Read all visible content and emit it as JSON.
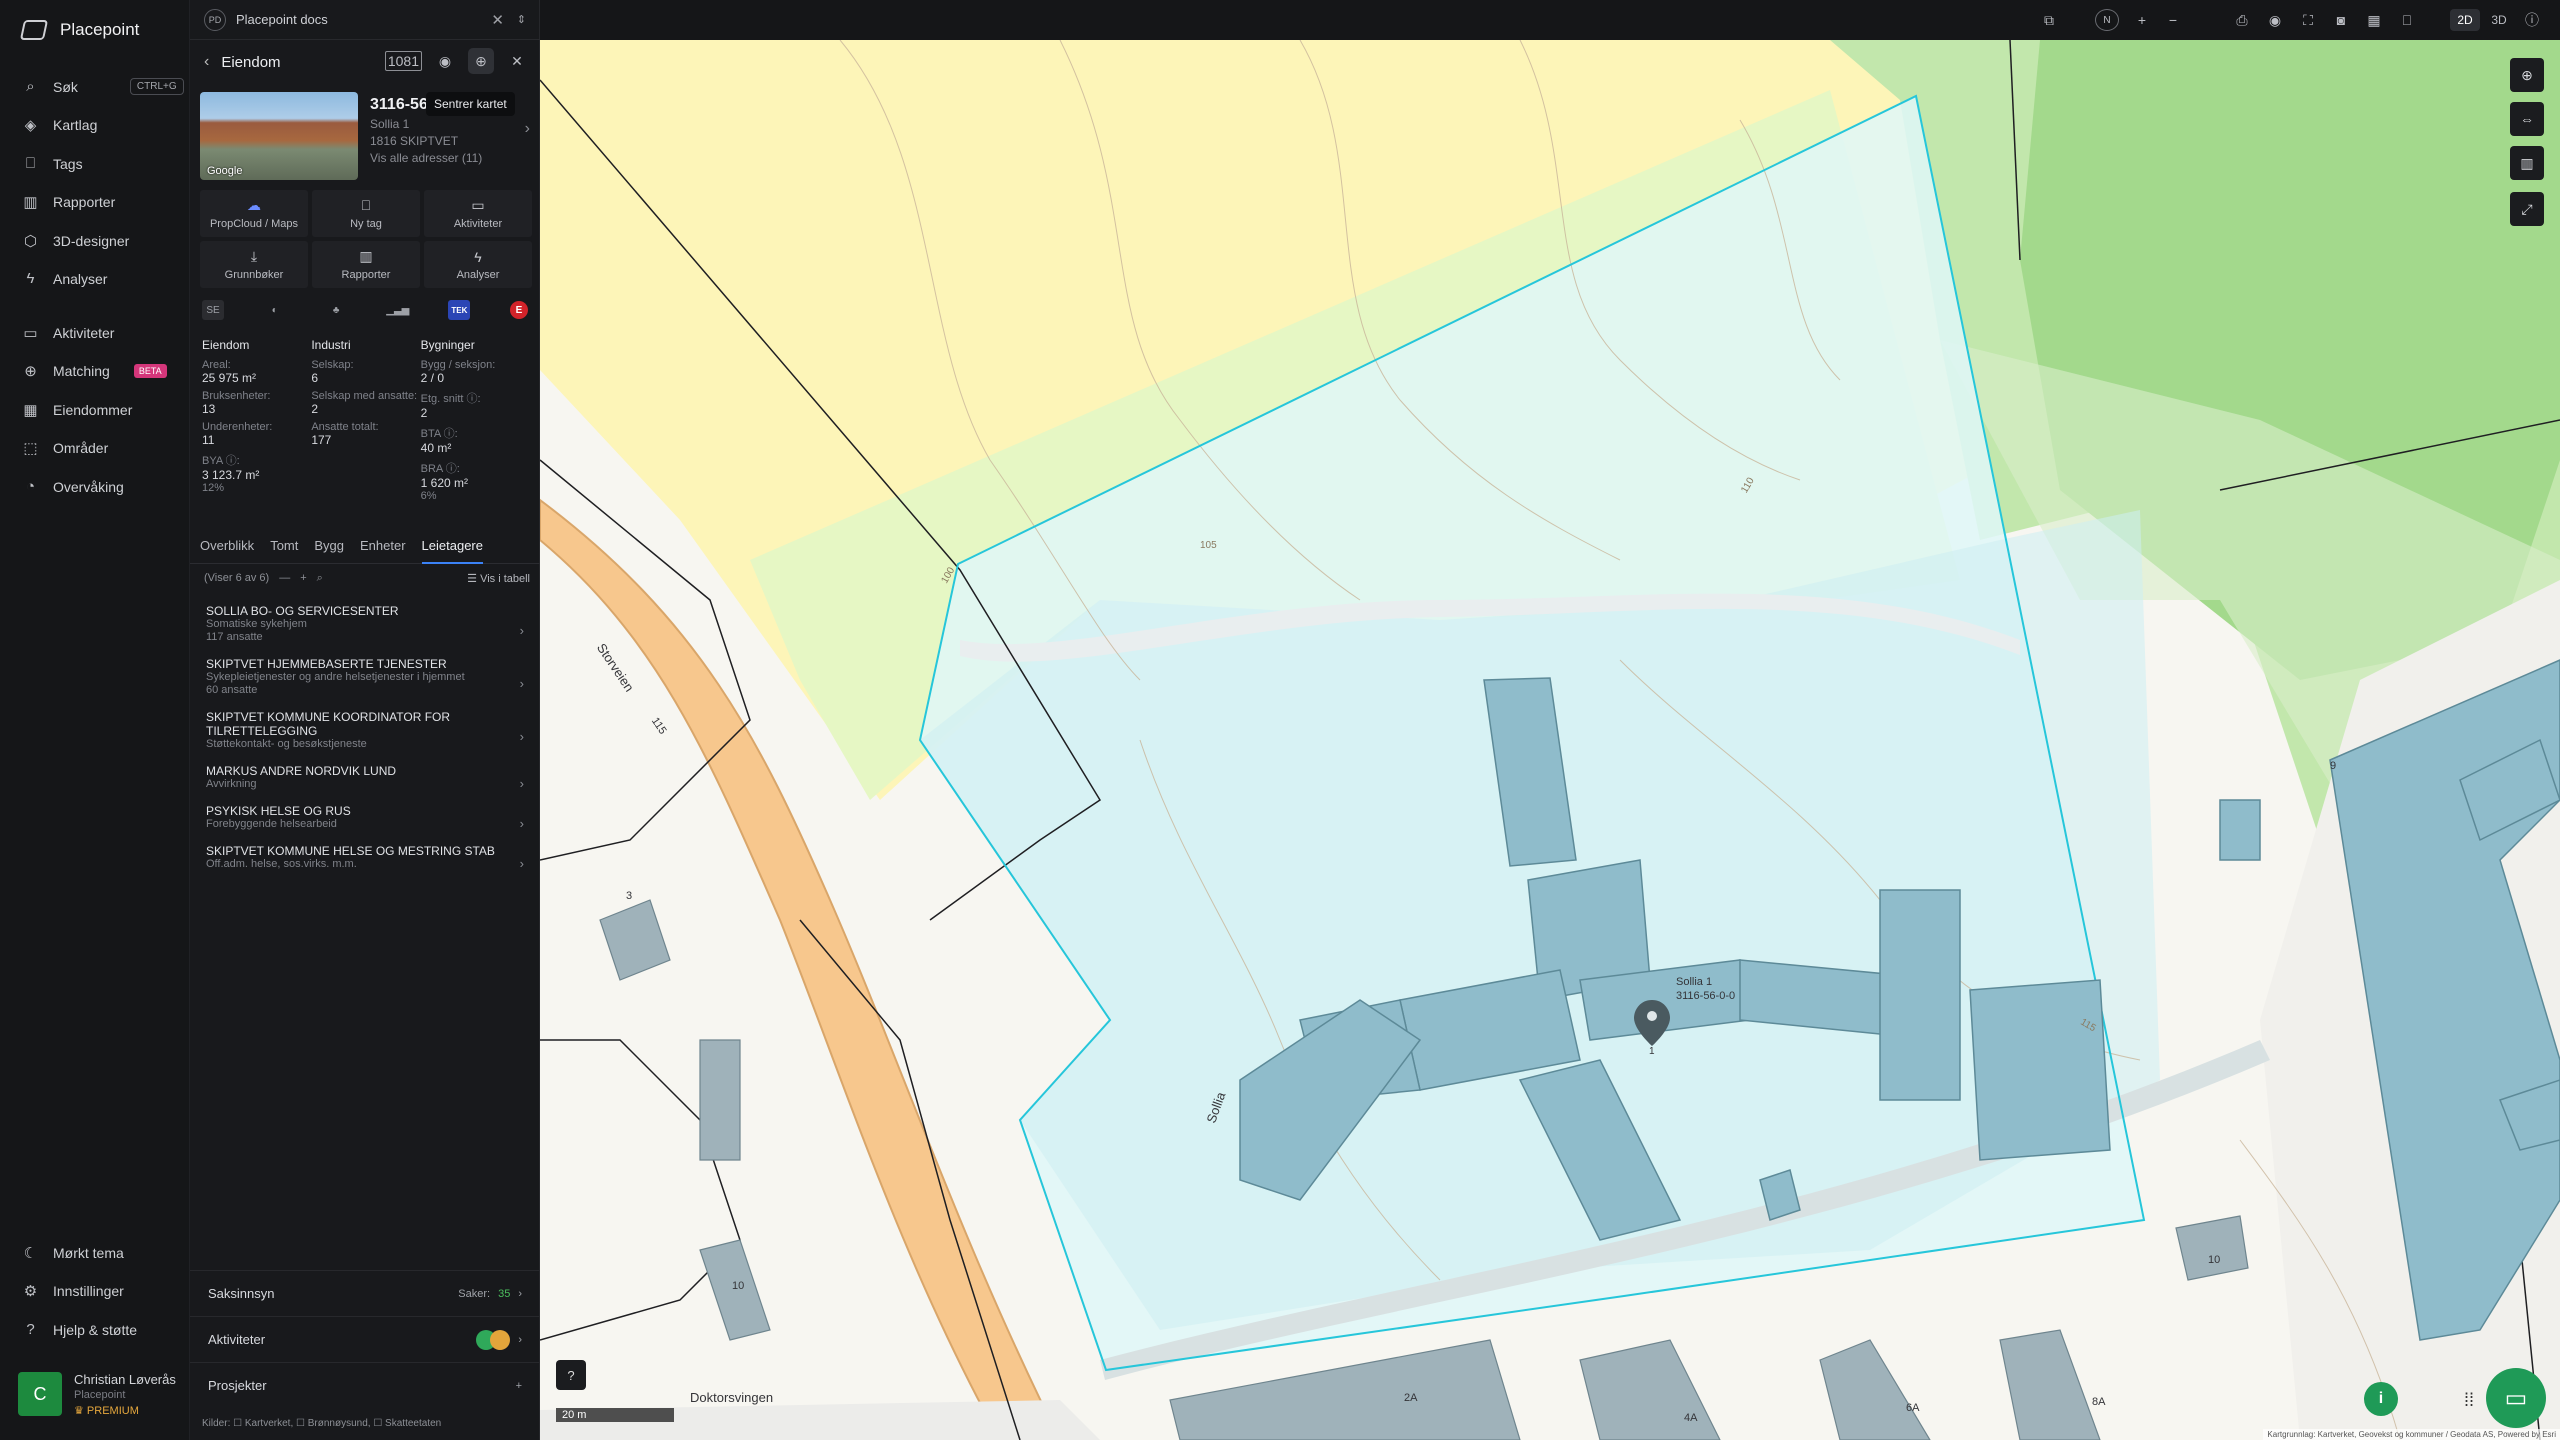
{
  "app": {
    "name": "Placepoint"
  },
  "nav": {
    "items": [
      {
        "label": "Søk",
        "icon": "search-icon",
        "shortcut": "CTRL+G"
      },
      {
        "label": "Kartlag",
        "icon": "layers-icon"
      },
      {
        "label": "Tags",
        "icon": "bookmark-icon"
      },
      {
        "label": "Rapporter",
        "icon": "chart-icon"
      },
      {
        "label": "3D-designer",
        "icon": "cube-icon"
      },
      {
        "label": "Analyser",
        "icon": "bolt-icon"
      },
      {
        "label": "Aktiviteter",
        "icon": "chat-icon"
      },
      {
        "label": "Matching",
        "icon": "match-icon",
        "badge": "BETA"
      },
      {
        "label": "Eiendommer",
        "icon": "building-icon"
      },
      {
        "label": "Områder",
        "icon": "area-icon"
      },
      {
        "label": "Overvåking",
        "icon": "monitor-icon"
      }
    ],
    "bottom": [
      {
        "label": "Mørkt tema",
        "icon": "moon-icon"
      },
      {
        "label": "Innstillinger",
        "icon": "gear-icon"
      },
      {
        "label": "Hjelp & støtte",
        "icon": "help-icon"
      }
    ],
    "user": {
      "initial": "C",
      "name": "Christian Løverås",
      "org": "Placepoint",
      "plan": "PREMIUM"
    }
  },
  "doc": {
    "badge": "PD",
    "title": "Placepoint docs"
  },
  "panel": {
    "title": "Eiendom",
    "tooltip": "Sentrer kartet",
    "icons": {
      "badge": "1081"
    },
    "property": {
      "gnr": "3116-56",
      "address": "Sollia 1",
      "postal": "1816 SKIPTVET",
      "all_addresses": "Vis alle adresser (11)",
      "photo_credit": "Google"
    },
    "actions": [
      {
        "label": "PropCloud / Maps",
        "icon": "cloud-icon"
      },
      {
        "label": "Ny tag",
        "icon": "bookmark-icon"
      },
      {
        "label": "Aktiviteter",
        "icon": "chat-icon"
      },
      {
        "label": "Grunnbøker",
        "icon": "download-icon"
      },
      {
        "label": "Rapporter",
        "icon": "chart-icon"
      },
      {
        "label": "Analyser",
        "icon": "bolt-icon"
      }
    ],
    "sources": [
      "SE",
      "TEK",
      "E"
    ],
    "stats": {
      "cols": [
        {
          "heading": "Eiendom",
          "rows": [
            {
              "k": "Areal:",
              "v": "25 975 m²"
            },
            {
              "k": "Bruksenheter:",
              "v": "13"
            },
            {
              "k": "Underenheter:",
              "v": "11"
            },
            {
              "k": "BYA ⓘ:",
              "v": "3 123.7 m²",
              "s": "12%"
            }
          ]
        },
        {
          "heading": "Industri",
          "rows": [
            {
              "k": "Selskap:",
              "v": "6"
            },
            {
              "k": "Selskap med ansatte:",
              "v": "2"
            },
            {
              "k": "Ansatte totalt:",
              "v": "177"
            }
          ]
        },
        {
          "heading": "Bygninger",
          "rows": [
            {
              "k": "Bygg / seksjon:",
              "v": "2 / 0"
            },
            {
              "k": "Etg. snitt ⓘ:",
              "v": "2"
            },
            {
              "k": "BTA ⓘ:",
              "v": "40 m²"
            },
            {
              "k": "BRA ⓘ:",
              "v": "1 620 m²",
              "s": "6%"
            }
          ]
        }
      ]
    },
    "tabs": [
      "Overblikk",
      "Tomt",
      "Bygg",
      "Enheter",
      "Leietagere"
    ],
    "active_tab": "Leietagere",
    "list": {
      "count": "(Viser 6 av 6)",
      "view_toggle": "Vis i tabell"
    },
    "tenants": [
      {
        "name": "SOLLIA BO- OG SERVICESENTER",
        "desc": "Somatiske sykehjem",
        "emp": "117 ansatte"
      },
      {
        "name": "SKIPTVET HJEMMEBASERTE TJENESTER",
        "desc": "Sykepleietjenester og andre helsetjenester i hjemmet",
        "emp": "60 ansatte"
      },
      {
        "name": "SKIPTVET KOMMUNE KOORDINATOR FOR TILRETTELEGGING",
        "desc": "Støttekontakt- og besøkstjeneste",
        "emp": ""
      },
      {
        "name": "MARKUS ANDRE NORDVIK LUND",
        "desc": "Avvirkning",
        "emp": ""
      },
      {
        "name": "PSYKISK HELSE OG RUS",
        "desc": "Forebyggende helsearbeid",
        "emp": ""
      },
      {
        "name": "SKIPTVET KOMMUNE HELSE OG MESTRING STAB",
        "desc": "Off.adm. helse, sos.virks. m.m.",
        "emp": ""
      }
    ],
    "sections": [
      {
        "label": "Saksinnsyn",
        "right_label": "Saker:",
        "right_value": "35"
      },
      {
        "label": "Aktiviteter"
      },
      {
        "label": "Prosjekter"
      }
    ],
    "sources_footer": "Kilder: ☐ Kartverket, ☐ Brønnøysund, ☐ Skatteetaten"
  },
  "map": {
    "mode_2d": "2D",
    "mode_3d": "3D",
    "compass": "N",
    "labels": [
      {
        "text": "Storveien",
        "kind": "road"
      },
      {
        "text": "Sollia",
        "kind": "road"
      },
      {
        "text": "Doktorsvingen",
        "kind": "road"
      },
      {
        "text": "115",
        "kind": "route"
      },
      {
        "text": "Sollia 1",
        "kind": "address"
      },
      {
        "text": "3116-56-0-0",
        "kind": "parcel"
      }
    ],
    "contours": [
      "100",
      "105",
      "110",
      "115"
    ],
    "house_numbers": [
      "3",
      "9",
      "10",
      "10",
      "2A",
      "4A",
      "6A",
      "8A",
      "1"
    ],
    "scale": "20 m",
    "attribution": "Kartgrunnlag: Kartverket, Geovekst og kommuner / Geodata AS, Powered by Esri",
    "colors": {
      "parcel": "#26c6da",
      "zone_yellow": "#fff6b3",
      "zone_green": "#bfe6a8",
      "building": "#8fbccb",
      "road": "#f7c78d"
    }
  }
}
